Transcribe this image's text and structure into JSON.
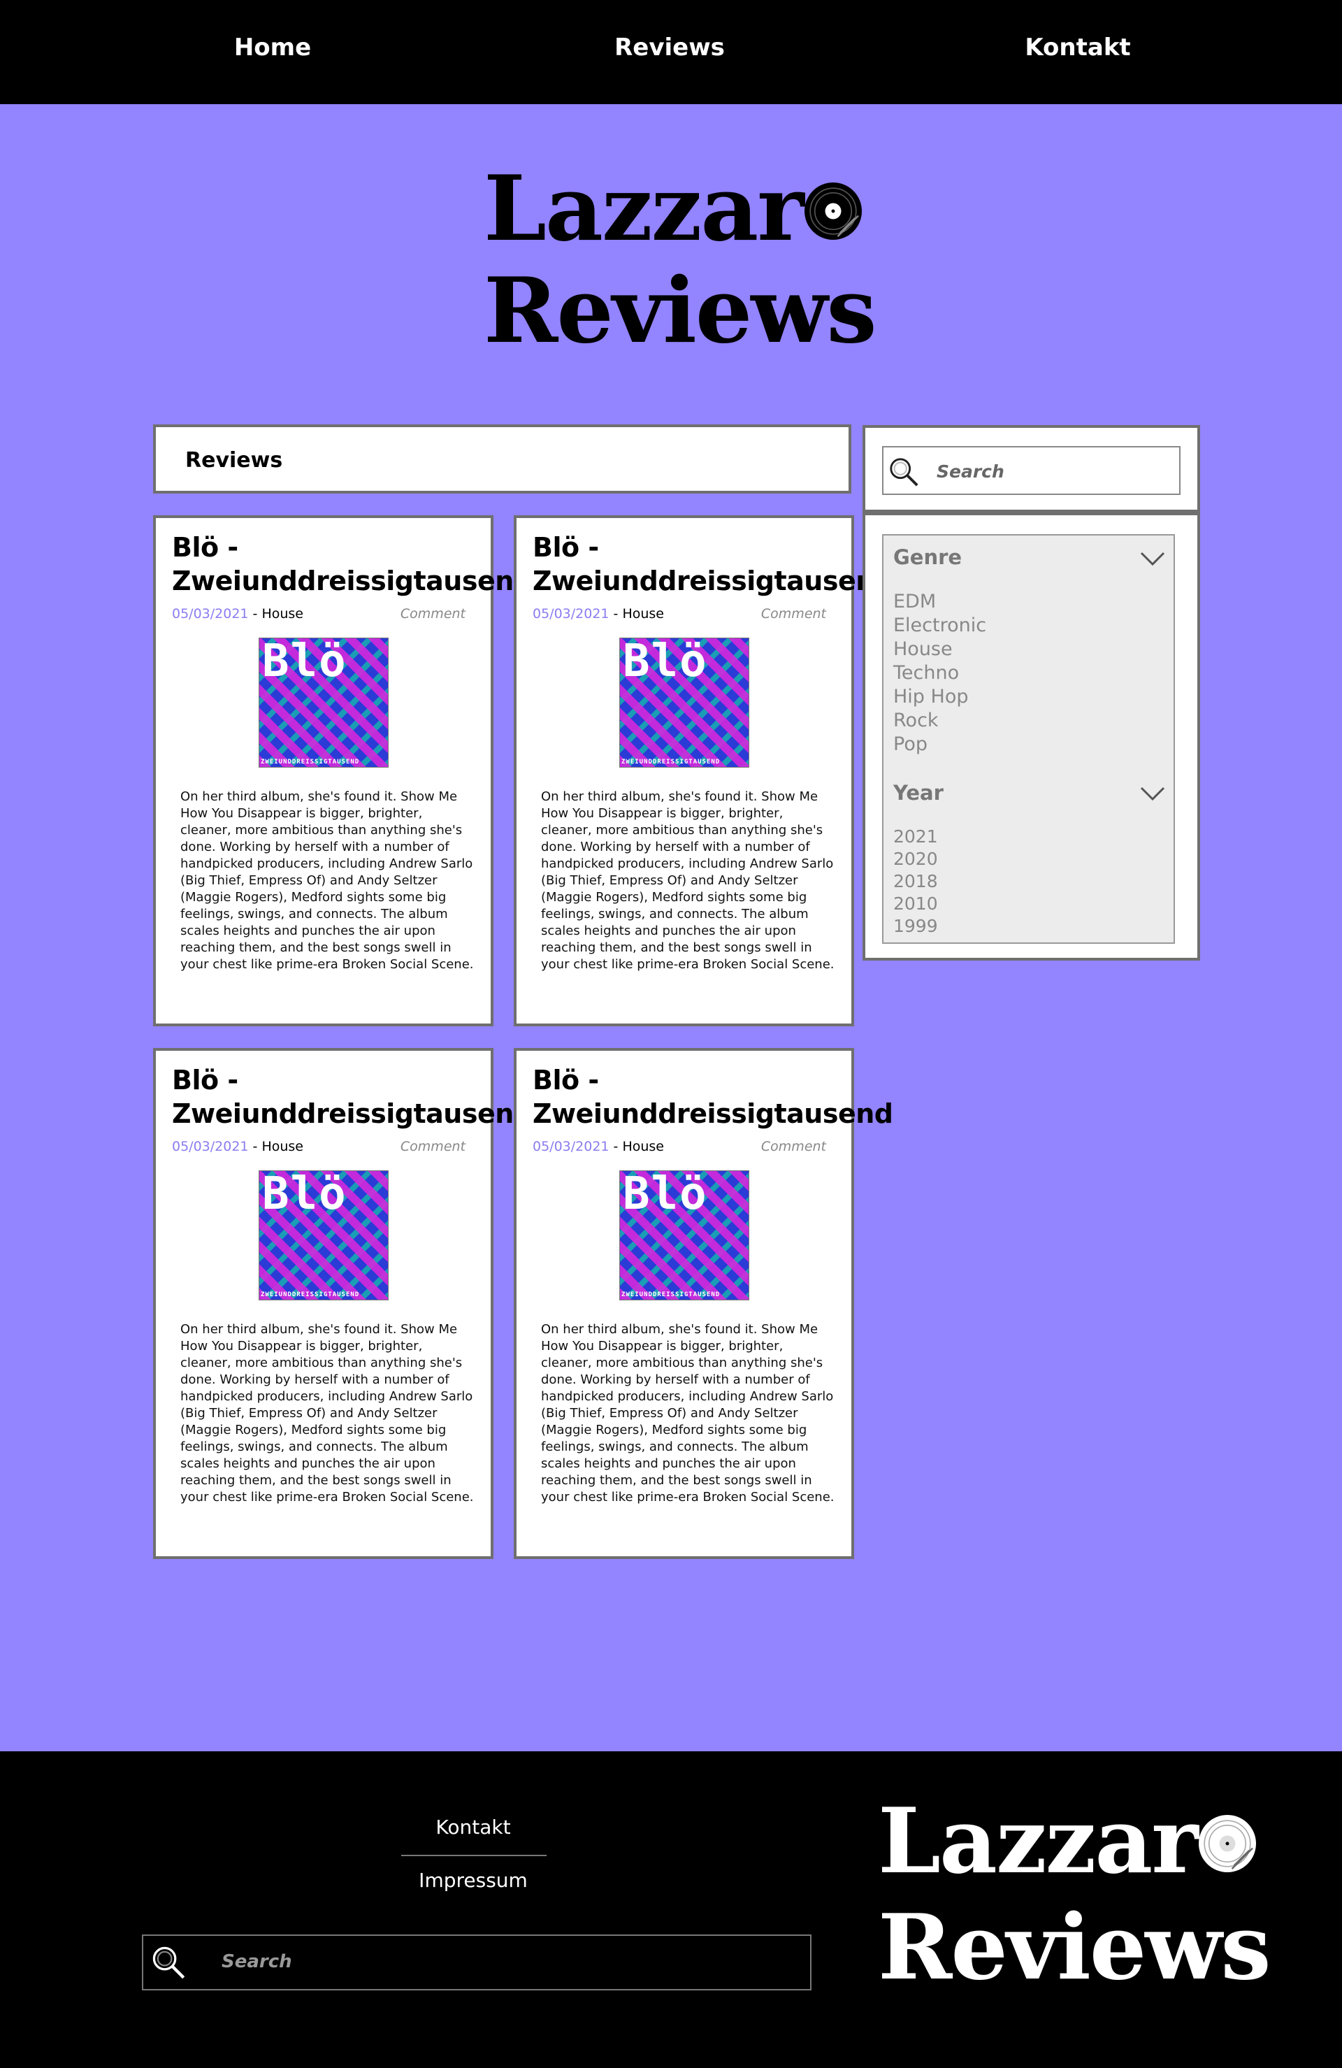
{
  "nav": {
    "home": "Home",
    "reviews": "Reviews",
    "kontakt": "Kontakt"
  },
  "logo": {
    "line1": "Lazzar",
    "line2": "Reviews",
    "icon": "vinyl-record-icon"
  },
  "section_title": "Reviews",
  "cards": [
    {
      "title": "Blö - Zweiunddreissigtausend",
      "date": "05/03/2021",
      "sep": " - ",
      "genre": "House",
      "comment": "Comment",
      "cover_title": "Blö",
      "cover_sub": "ZWEIUNDDREISSIGTAUSEND",
      "body": "On her third album, she's found it. Show Me How You Disappear is bigger, brighter, cleaner, more ambitious than anything she's done. Working by herself with a number of handpicked producers, including Andrew Sarlo (Big Thief, Empress Of) and Andy Seltzer (Maggie Rogers), Medford sights some big feelings, swings, and connects. The album scales heights and punches the air upon reaching them, and the best songs swell in your chest like prime-era Broken Social Scene."
    },
    {
      "title": "Blö - Zweiunddreissigtausend",
      "date": "05/03/2021",
      "sep": " - ",
      "genre": "House",
      "comment": "Comment",
      "cover_title": "Blö",
      "cover_sub": "ZWEIUNDDREISSIGTAUSEND",
      "body": "On her third album, she's found it. Show Me How You Disappear is bigger, brighter, cleaner, more ambitious than anything she's done. Working by herself with a number of handpicked producers, including Andrew Sarlo (Big Thief, Empress Of) and Andy Seltzer (Maggie Rogers), Medford sights some big feelings, swings, and connects. The album scales heights and punches the air upon reaching them, and the best songs swell in your chest like prime-era Broken Social Scene."
    },
    {
      "title": "Blö - Zweiunddreissigtausend",
      "date": "05/03/2021",
      "sep": " - ",
      "genre": "House",
      "comment": "Comment",
      "cover_title": "Blö",
      "cover_sub": "ZWEIUNDDREISSIGTAUSEND",
      "body": "On her third album, she's found it. Show Me How You Disappear is bigger, brighter, cleaner, more ambitious than anything she's done. Working by herself with a number of handpicked producers, including Andrew Sarlo (Big Thief, Empress Of) and Andy Seltzer (Maggie Rogers), Medford sights some big feelings, swings, and connects. The album scales heights and punches the air upon reaching them, and the best songs swell in your chest like prime-era Broken Social Scene."
    },
    {
      "title": "Blö - Zweiunddreissigtausend",
      "date": "05/03/2021",
      "sep": " - ",
      "genre": "House",
      "comment": "Comment",
      "cover_title": "Blö",
      "cover_sub": "ZWEIUNDDREISSIGTAUSEND",
      "body": "On her third album, she's found it. Show Me How You Disappear is bigger, brighter, cleaner, more ambitious than anything she's done. Working by herself with a number of handpicked producers, including Andrew Sarlo (Big Thief, Empress Of) and Andy Seltzer (Maggie Rogers), Medford sights some big feelings, swings, and connects. The album scales heights and punches the air upon reaching them, and the best songs swell in your chest like prime-era Broken Social Scene."
    }
  ],
  "sidebar": {
    "search_placeholder": "Search",
    "genre": {
      "label": "Genre",
      "items": [
        "EDM",
        "Electronic",
        "House",
        "Techno",
        "Hip Hop",
        "Rock",
        "Pop"
      ]
    },
    "year": {
      "label": "Year",
      "items": [
        "2021",
        "2020",
        "2018",
        "2010",
        "1999"
      ]
    }
  },
  "footer": {
    "kontakt": "Kontakt",
    "impressum": "Impressum",
    "search_placeholder": "Search"
  },
  "colors": {
    "background": "#9384ff",
    "bar": "#000000",
    "date_accent": "#8a7cf0",
    "border": "#6f6f6f"
  }
}
